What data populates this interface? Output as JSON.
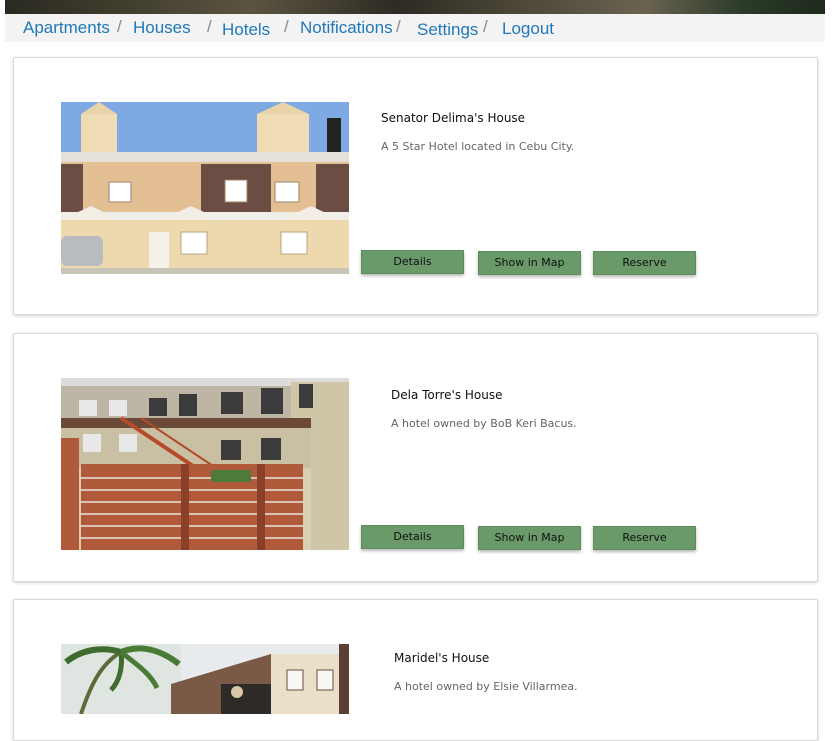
{
  "nav": {
    "items": [
      {
        "label": "Apartments"
      },
      {
        "label": "Houses"
      },
      {
        "label": "Hotels"
      },
      {
        "label": "Notifications"
      },
      {
        "label": "Settings"
      },
      {
        "label": "Logout"
      }
    ],
    "separator": "/"
  },
  "listings": [
    {
      "title": "Senator Delima's House",
      "description": "A 5 Star Hotel located in Cebu City.",
      "buttons": {
        "details": "Details",
        "map": "Show in Map",
        "reserve": "Reserve"
      }
    },
    {
      "title": "Dela Torre's House",
      "description": "A hotel owned by BoB Keri Bacus.",
      "buttons": {
        "details": "Details",
        "map": "Show in Map",
        "reserve": "Reserve"
      }
    },
    {
      "title": "Maridel's House",
      "description": "A hotel owned by Elsie Villarmea."
    }
  ],
  "colors": {
    "nav_link": "#1f78b8",
    "nav_bg": "#f3f3f3",
    "button_bg": "#6a9a6a"
  }
}
